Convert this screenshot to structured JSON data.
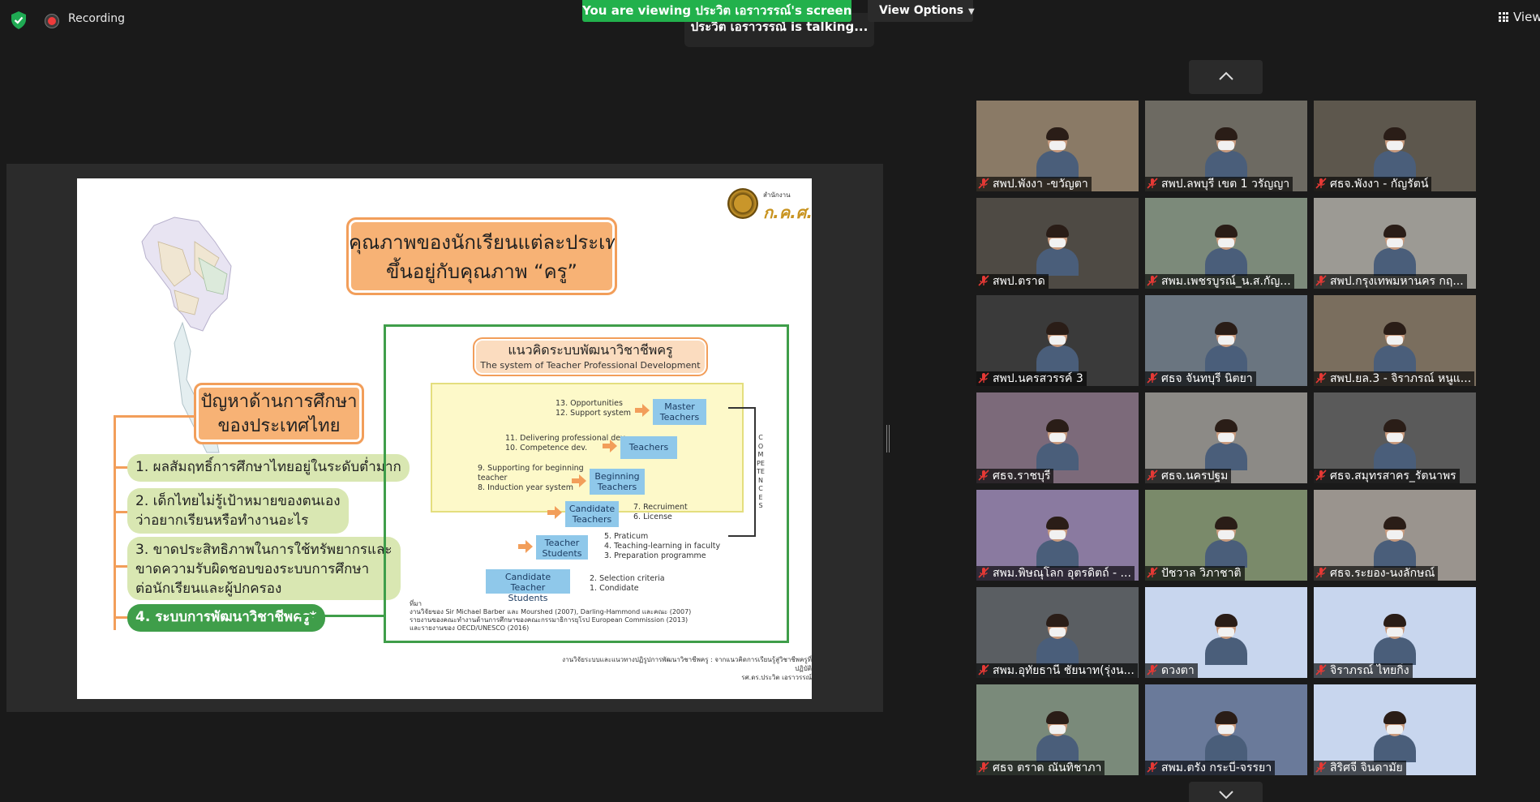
{
  "status": {
    "recording_label": "Recording"
  },
  "banner": {
    "viewing_text": "You are viewing ประวิต เอราวรรณ์'s screen",
    "view_options_label": "View Options",
    "talking_text": "ประวิต เอราวรรณ์ is talking...",
    "view_label": "View"
  },
  "slide": {
    "title_line1": "คุณภาพของนักเรียนแต่ละประเทศ",
    "title_line2": "ขึ้นอยู่กับคุณภาพ “ครู”",
    "logo_small": "สำนักงาน",
    "logo_big": "ก.ค.ศ.",
    "problem_line1": "ปัญหาด้านการศึกษา",
    "problem_line2": "ของประเทศไทย",
    "problems": [
      {
        "text": "1. ผลสัมฤทธิ์การศึกษาไทยอยู่ในระดับต่ำมาก"
      },
      {
        "text": "2. เด็กไทยไม่รู้เป้าหมายของตนเอง\nว่าอยากเรียนหรือทำงานอะไร"
      },
      {
        "text": "3. ขาดประสิทธิภาพในการใช้ทรัพยากรและ\nขาดความรับผิดชอบของระบบการศึกษา\nต่อนักเรียนและผู้ปกครอง"
      },
      {
        "text": "4. ระบบการพัฒนาวิชาชีพครู*"
      }
    ],
    "pd_title_th": "แนวคิดระบบพัฒนาวิชาชีพครู",
    "pd_title_en": "The system of Teacher Professional Development",
    "steps": [
      {
        "label": "Master\nTeachers",
        "text": "13. Opportunities\n12. Support system"
      },
      {
        "label": "Teachers",
        "text": "11. Delivering professional dev.\n10. Competence dev."
      },
      {
        "label": "Beginning\nTeachers",
        "text": "9. Supporting for beginning\n   teacher\n8. Induction year system"
      },
      {
        "label": "Candidate\nTeachers",
        "text": "7. Recruiment\n6. License"
      },
      {
        "label": "Teacher\nStudents",
        "text": "5. Praticum\n4. Teaching-learning in faculty\n3. Preparation programme"
      },
      {
        "label": "Candidate Teacher\nStudents",
        "text": "2. Selection criteria\n1. Condidate"
      }
    ],
    "competences": "COMPETENCES",
    "source": "ที่มา\nงานวิจัยของ Sir Michael Barber และ Mourshed (2007), Darling-Hammond และคณะ (2007)\nรายงานของคณะทำงานด้านการศึกษาของคณะกรรมาธิการยุโรป European Commission (2013)\nและรายงานของ OECD/UNESCO (2016)",
    "credit": "งานวิจัยระบบและแนวทางปฏิรูปการพัฒนาวิชาชีพครู : จากแนวคิดการเรียนรู้สู่วิชาชีพครูที่ปฏิบัติ\nรศ.ดร.ประวิต เอราวรรณ์"
  },
  "participants": [
    {
      "name": "สพป.พังงา -ขวัญตา",
      "scene": "#8a7a66"
    },
    {
      "name": "สพป.ลพบุรี เขต 1 วรัญญา",
      "scene": "#6d6a62"
    },
    {
      "name": "ศธจ.พังงา - กัญรัตน์",
      "scene": "#5d574d"
    },
    {
      "name": "สพป.ตราด",
      "scene": "#4e4a44"
    },
    {
      "name": "สพม.เพชรบูรณ์_น.ส.กัญ...",
      "scene": "#7c8a7a"
    },
    {
      "name": "สพป.กรุงเทพมหานคร กฤ...",
      "scene": "#9c9a94"
    },
    {
      "name": "สพป.นครสวรรค์ 3",
      "scene": "#3a3a3a"
    },
    {
      "name": "ศธจ จันทบุรี นิตยา",
      "scene": "#6a7580"
    },
    {
      "name": "สพป.ยล.3 - จิราภรณ์ หนูแ...",
      "scene": "#7a6e5e"
    },
    {
      "name": "ศธจ.ราชบุรี",
      "scene": "#7c6a7a"
    },
    {
      "name": "ศธจ.นครปฐม",
      "scene": "#8c8a86"
    },
    {
      "name": "ศธจ.สมุทรสาคร_รัตนาพร",
      "scene": "#5a5a5a"
    },
    {
      "name": "สพม.พิษณุโลก อุตรดิตถ์ - ...",
      "scene": "#8a7aa0"
    },
    {
      "name": "ปัชวาล วิภาชาติ",
      "scene": "#7a8a6a"
    },
    {
      "name": "ศธจ.ระยอง-นงลักษณ์",
      "scene": "#9a948e"
    },
    {
      "name": "สพม.อุทัยธานี ชัยนาท(รุ่งน...",
      "scene": "#5a5e62"
    },
    {
      "name": "ดวงตา",
      "scene": "#c8d6ee"
    },
    {
      "name": "จิราภรณ์ ไทยกิ่ง",
      "scene": "#c8d6ee"
    },
    {
      "name": "ศธจ ตราด ณันทิชาภา",
      "scene": "#7a8a7a"
    },
    {
      "name": "สพม.ตรัง กระบี่-จรรยา",
      "scene": "#6a7a9a"
    },
    {
      "name": "สิริศจี จินดามัย",
      "scene": "#c8d6ee"
    }
  ],
  "colors": {
    "banner_green": "#22b14c",
    "mic_muted": "#e53935",
    "slide_orange": "#f7b275",
    "slide_green": "#3f9e4a",
    "step_blue": "#8fc8ea"
  }
}
